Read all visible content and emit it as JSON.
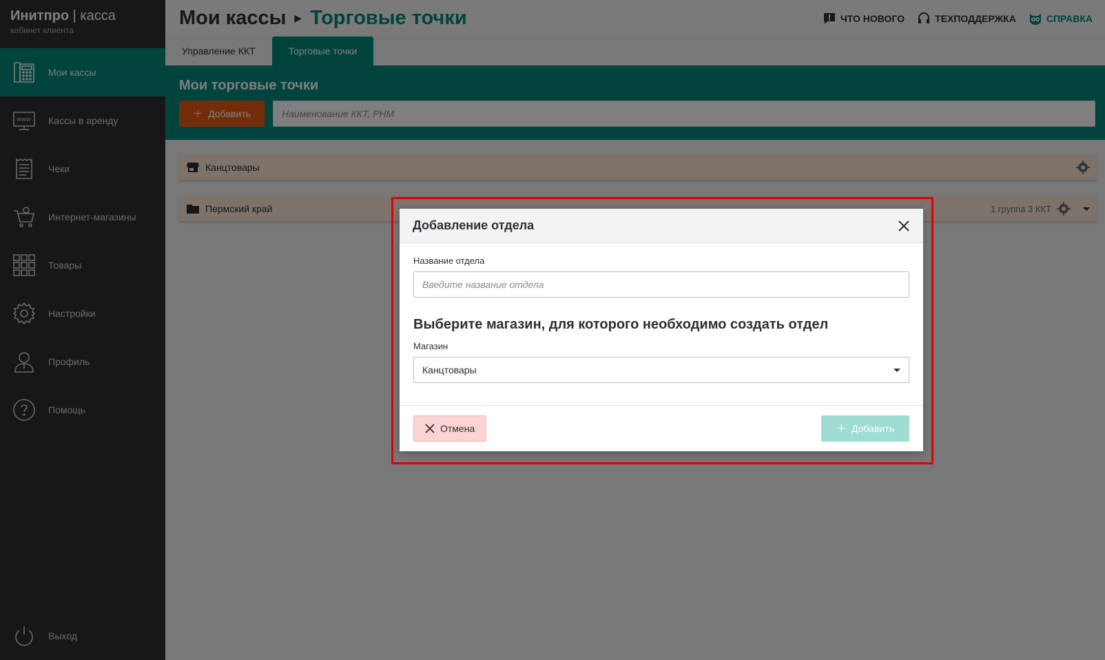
{
  "brand": {
    "name": "Инитпро",
    "name_sep": " | ",
    "name_suffix": "касса",
    "subtitle": "кабинет клиента"
  },
  "sidebar": {
    "items": [
      {
        "label": "Мои кассы",
        "icon": "cash-register-icon",
        "active": true
      },
      {
        "label": "Кассы в аренду",
        "icon": "www-monitor-icon"
      },
      {
        "label": "Чеки",
        "icon": "receipt-icon"
      },
      {
        "label": "Интернет-магазины",
        "icon": "cart-icon"
      },
      {
        "label": "Товары",
        "icon": "grid-icon"
      },
      {
        "label": "Настройки",
        "icon": "gear-icon"
      },
      {
        "label": "Профиль",
        "icon": "user-icon"
      },
      {
        "label": "Помощь",
        "icon": "question-icon"
      }
    ],
    "logout": {
      "label": "Выход",
      "icon": "power-icon"
    }
  },
  "header": {
    "crumb_root": "Мои кассы",
    "crumb_current": "Торговые точки",
    "links": {
      "whats_new": "ЧТО НОВОГО",
      "support": "ТЕХПОДДЕРЖКА",
      "help": "СПРАВКА"
    }
  },
  "tabs": [
    {
      "label": "Управление ККТ"
    },
    {
      "label": "Торговые точки",
      "active": true
    }
  ],
  "panel": {
    "title": "Мои торговые точки",
    "add_label": "Добавить",
    "search_placeholder": "Наименование ККТ, РНМ"
  },
  "list": [
    {
      "name": "Канцтовары",
      "icon": "store-icon"
    },
    {
      "name": "Пермский край",
      "icon": "folder-icon",
      "meta": "1 группа 3 ККТ"
    }
  ],
  "modal": {
    "title": "Добавление отдела",
    "name_label": "Название отдела",
    "name_placeholder": "Введите название отдела",
    "section_title": "Выберите магазин, для которого необходимо создать отдел",
    "store_label": "Магазин",
    "store_value": "Канцтовары",
    "cancel_label": "Отмена",
    "confirm_label": "Добавить"
  },
  "colors": {
    "accent": "#00897b",
    "sidebar": "#2b2f33",
    "add_button": "#e65c13",
    "highlight": "#e00000"
  }
}
